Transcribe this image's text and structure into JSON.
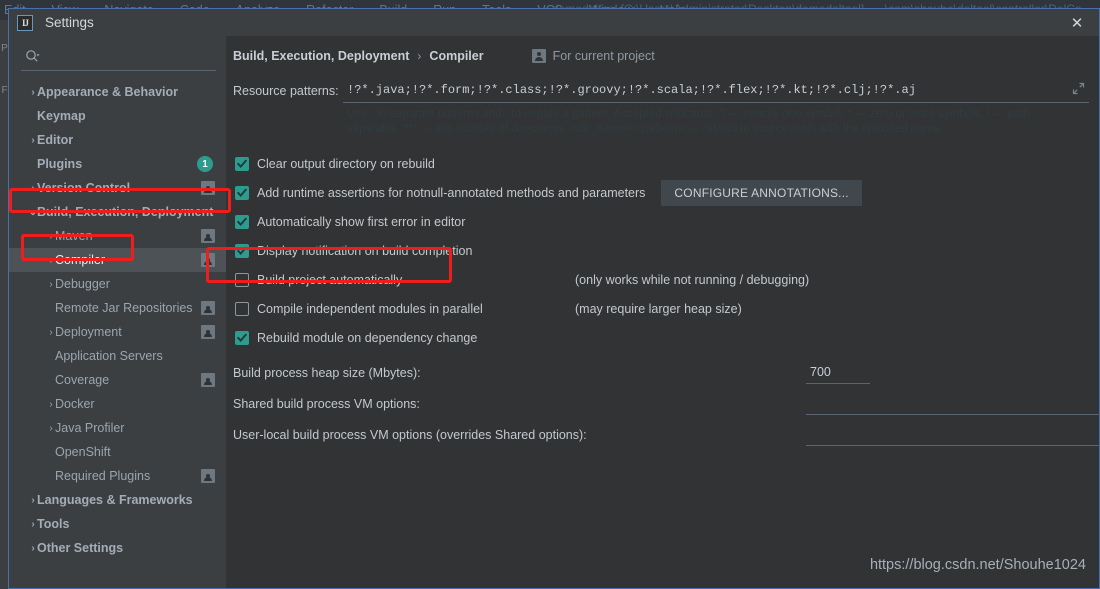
{
  "ide": {
    "menu_items": [
      "Edit",
      "View",
      "Navigate",
      "Code",
      "Analyze",
      "Refactor",
      "Build",
      "Run",
      "Tools",
      "VCS",
      "Window",
      "Help"
    ],
    "window_title": "demodeltool [C:\\Users\\Administrator\\Desktop\\demodeltool] - ...\\com\\shouhe\\deltool\\controller\\DelCo",
    "left_strip_letters": [
      "P",
      "F"
    ]
  },
  "dialog": {
    "title": "Settings",
    "logo_text": "IJ",
    "close_label": "✕"
  },
  "search": {
    "value": "",
    "placeholder": ""
  },
  "sidebar": {
    "items": [
      {
        "label": "Appearance & Behavior",
        "level": 0,
        "chevron": "›",
        "selected": false,
        "badge": null,
        "project_icon": false
      },
      {
        "label": "Keymap",
        "level": 0,
        "chevron": "",
        "selected": false,
        "badge": null,
        "project_icon": false
      },
      {
        "label": "Editor",
        "level": 0,
        "chevron": "›",
        "selected": false,
        "badge": null,
        "project_icon": false
      },
      {
        "label": "Plugins",
        "level": 0,
        "chevron": "",
        "selected": false,
        "badge": "1",
        "project_icon": false
      },
      {
        "label": "Version Control",
        "level": 0,
        "chevron": "›",
        "selected": false,
        "badge": null,
        "project_icon": true
      },
      {
        "label": "Build, Execution, Deployment",
        "level": 0,
        "chevron": "⌄",
        "selected": false,
        "badge": null,
        "project_icon": false
      },
      {
        "label": "Maven",
        "level": 1,
        "chevron": "›",
        "selected": false,
        "badge": null,
        "project_icon": true
      },
      {
        "label": "Compiler",
        "level": 1,
        "chevron": "›",
        "selected": true,
        "badge": null,
        "project_icon": true
      },
      {
        "label": "Debugger",
        "level": 1,
        "chevron": "›",
        "selected": false,
        "badge": null,
        "project_icon": false
      },
      {
        "label": "Remote Jar Repositories",
        "level": 1,
        "chevron": "",
        "selected": false,
        "badge": null,
        "project_icon": true
      },
      {
        "label": "Deployment",
        "level": 1,
        "chevron": "›",
        "selected": false,
        "badge": null,
        "project_icon": true
      },
      {
        "label": "Application Servers",
        "level": 1,
        "chevron": "",
        "selected": false,
        "badge": null,
        "project_icon": false
      },
      {
        "label": "Coverage",
        "level": 1,
        "chevron": "",
        "selected": false,
        "badge": null,
        "project_icon": true
      },
      {
        "label": "Docker",
        "level": 1,
        "chevron": "›",
        "selected": false,
        "badge": null,
        "project_icon": false
      },
      {
        "label": "Java Profiler",
        "level": 1,
        "chevron": "›",
        "selected": false,
        "badge": null,
        "project_icon": false
      },
      {
        "label": "OpenShift",
        "level": 1,
        "chevron": "",
        "selected": false,
        "badge": null,
        "project_icon": false
      },
      {
        "label": "Required Plugins",
        "level": 1,
        "chevron": "",
        "selected": false,
        "badge": null,
        "project_icon": true
      },
      {
        "label": "Languages & Frameworks",
        "level": 0,
        "chevron": "›",
        "selected": false,
        "badge": null,
        "project_icon": false
      },
      {
        "label": "Tools",
        "level": 0,
        "chevron": "›",
        "selected": false,
        "badge": null,
        "project_icon": false
      },
      {
        "label": "Other Settings",
        "level": 0,
        "chevron": "›",
        "selected": false,
        "badge": null,
        "project_icon": false
      }
    ]
  },
  "main": {
    "breadcrumb_root": "Build, Execution, Deployment",
    "breadcrumb_sep": "›",
    "breadcrumb_leaf": "Compiler",
    "scope_label": "For current project",
    "resource_patterns": {
      "label": "Resource patterns:",
      "value": "!?*.java;!?*.form;!?*.class;!?*.groovy;!?*.scala;!?*.flex;!?*.kt;!?*.clj;!?*.aj",
      "hint_1": "Use ; to separate patterns and ! to negate a pattern. Accepted wildcards: ? — exactly one symbol, * — zero or more symbols, / — path",
      "hint_2": "separator, /**/ — any number of directories, <dir_name>:<pattern> — restrict to source roots with the specified name."
    },
    "options": [
      {
        "label": "Clear output directory on rebuild",
        "checked": true,
        "note": "",
        "button": ""
      },
      {
        "label": "Add runtime assertions for notnull-annotated methods and parameters",
        "checked": true,
        "note": "",
        "button": "CONFIGURE ANNOTATIONS..."
      },
      {
        "label": "Automatically show first error in editor",
        "checked": true,
        "note": "",
        "button": ""
      },
      {
        "label": "Display notification on build completion",
        "checked": true,
        "note": "",
        "button": ""
      },
      {
        "label": "Build project automatically",
        "checked": false,
        "note": "(only works while not running / debugging)",
        "button": ""
      },
      {
        "label": "Compile independent modules in parallel",
        "checked": false,
        "note": "(may require larger heap size)",
        "button": ""
      },
      {
        "label": "Rebuild module on dependency change",
        "checked": true,
        "note": "",
        "button": ""
      }
    ],
    "heap": {
      "label": "Build process heap size (Mbytes):",
      "value": "700"
    },
    "shared_vm": {
      "label": "Shared build process VM options:",
      "value": ""
    },
    "user_vm": {
      "label": "User-local build process VM options (overrides Shared options):",
      "value": ""
    }
  },
  "watermark": "https://blog.csdn.net/Shouhe1024",
  "colors": {
    "accent_checkbox": "#2d9c8f",
    "annotation_red": "#f01d1d",
    "dialog_border": "#4b6eaf",
    "panel_bg": "#3c3f41",
    "content_bg": "#313335"
  }
}
